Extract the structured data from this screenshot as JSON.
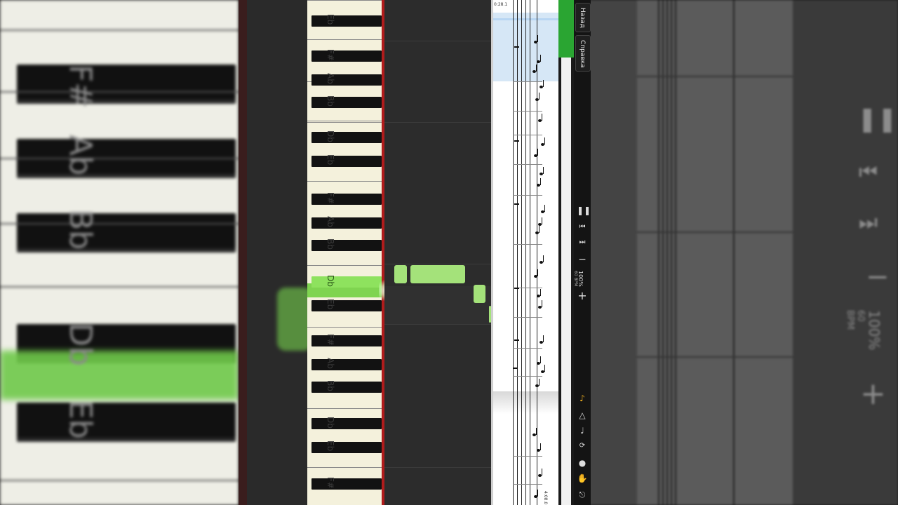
{
  "keyboard": {
    "keys": [
      {
        "label": "Eb",
        "pressed": false
      },
      {
        "label": "F#",
        "pressed": false
      },
      {
        "label": "Ab",
        "pressed": false
      },
      {
        "label": "Bb",
        "pressed": false
      },
      {
        "label": "Db",
        "pressed": false
      },
      {
        "label": "Eb",
        "pressed": false
      },
      {
        "label": "F#",
        "pressed": false
      },
      {
        "label": "Ab",
        "pressed": false
      },
      {
        "label": "Bb",
        "pressed": false
      },
      {
        "label": "Db",
        "pressed": true
      },
      {
        "label": "Eb",
        "pressed": false
      },
      {
        "label": "F#",
        "pressed": false
      },
      {
        "label": "Ab",
        "pressed": false
      },
      {
        "label": "Bb",
        "pressed": false
      },
      {
        "label": "Db",
        "pressed": false
      },
      {
        "label": "Eb",
        "pressed": false
      },
      {
        "label": "F#",
        "pressed": false
      }
    ],
    "colors": {
      "ivory": "#f4f1dc",
      "pressed": "#8ee25e",
      "playhead": "#b01c1c"
    }
  },
  "background_left": {
    "labels": [
      "F#",
      "Ab",
      "Bb",
      "Db",
      "Eb"
    ]
  },
  "score": {
    "start_time": "0:28.1",
    "end_time": "4:08.0"
  },
  "sidebar": {
    "back_label": "Назад",
    "help_label": "Справка",
    "zoom": "100%",
    "tempo": "60 BPM",
    "icons": [
      "pause-icon",
      "skip-back-icon",
      "skip-forward-icon",
      "minus-icon",
      "plus-icon",
      "note-icon",
      "metronome-icon",
      "guitar-icon",
      "loop-icon",
      "pin-icon",
      "hand-icon",
      "exit-icon"
    ]
  },
  "background_right": {
    "zoom": "100%",
    "tempo": "60 BPM"
  },
  "colors": {
    "note_fill": "#a4e27a",
    "progress": "#2aa532"
  }
}
